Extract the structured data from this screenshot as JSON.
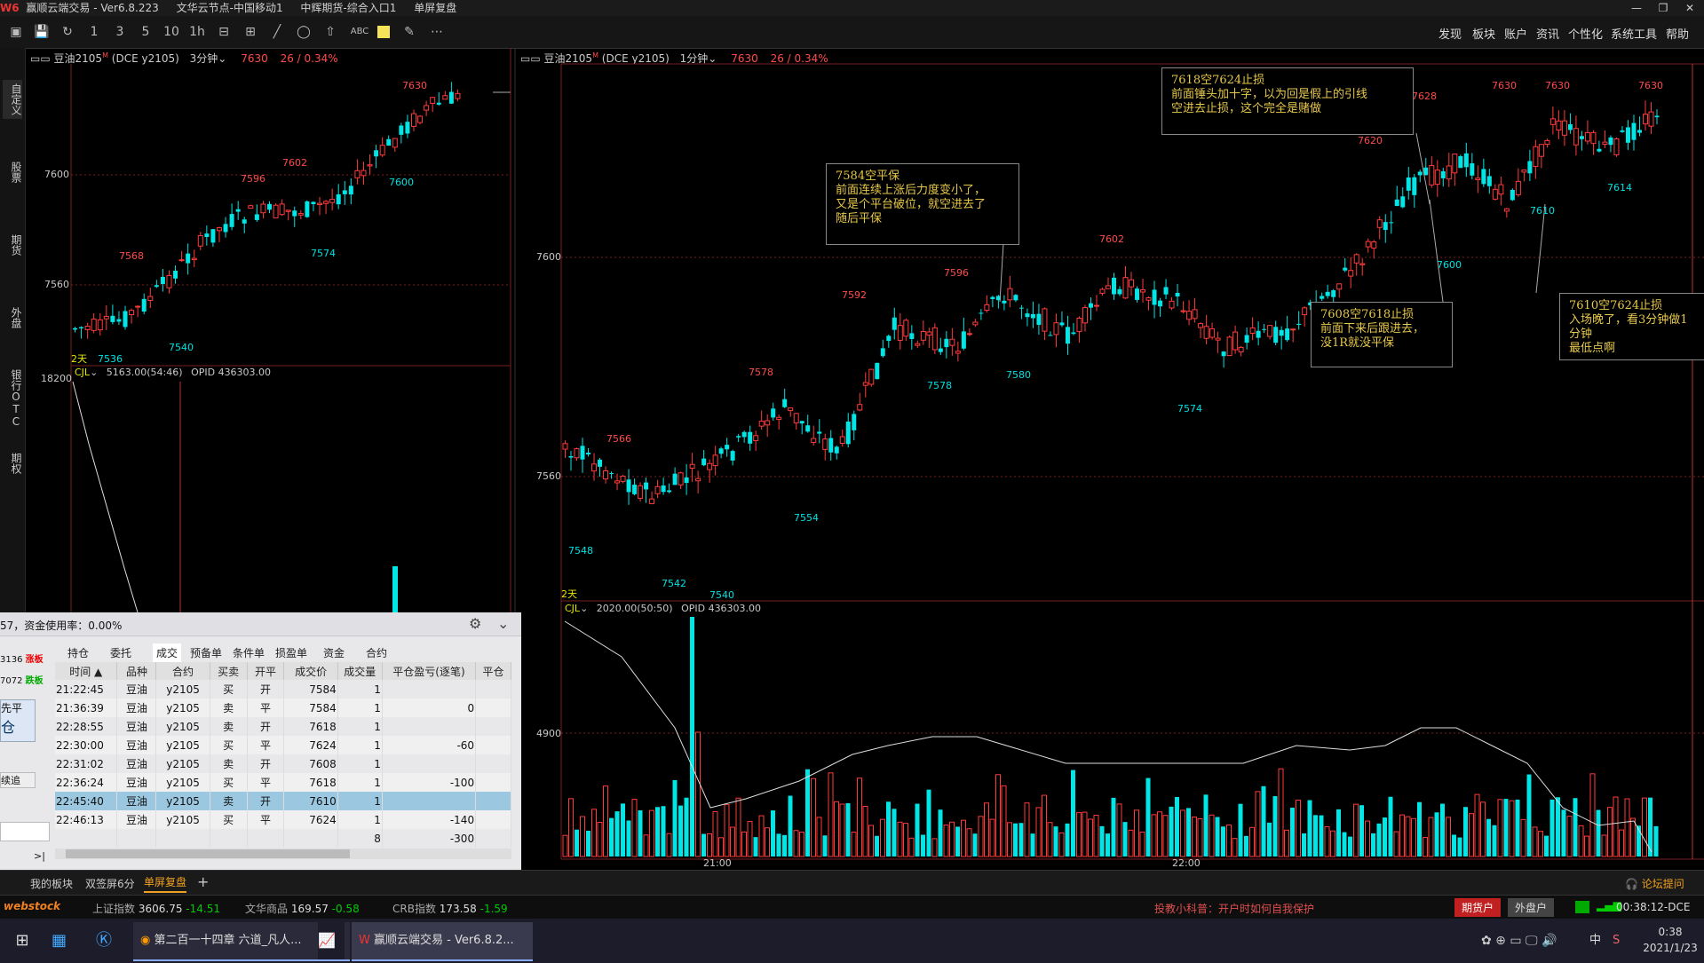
{
  "titlebar": {
    "app": "赢顺云端交易  - Ver6.8.223",
    "node": "文华云节点-中国移动1",
    "broker": "中辉期货-综合入口1",
    "mode": "单屏复盘"
  },
  "menu": [
    "发现",
    "板块",
    "账户",
    "资讯",
    "个性化",
    "系统工具",
    "帮助"
  ],
  "toolbar_icons": [
    "layout-icon",
    "save-icon",
    "refresh-icon",
    "1",
    "3",
    "5",
    "10",
    "1h",
    "grid-icon",
    "grid4-icon",
    "line-tool-icon",
    "ellipse-tool-icon",
    "arrow-up-icon",
    "ABC",
    "color-swatch-icon",
    "pen-icon",
    "more-icon"
  ],
  "sidebar_tabs": [
    "自定义",
    "股票",
    "期货",
    "外盘",
    "银行OTC",
    "期权"
  ],
  "left_chart": {
    "symbol": "豆油2105",
    "sup": "M",
    "exchange": "(DCE y2105)",
    "period": "3分钟",
    "last": "7630",
    "change": "26 / 0.34%",
    "price_labels": [
      "7600",
      "7560"
    ],
    "marks": [
      {
        "t": "7630",
        "c": "red"
      },
      {
        "t": "7602",
        "c": "red"
      },
      {
        "t": "7596",
        "c": "red"
      },
      {
        "t": "7568",
        "c": "red"
      },
      {
        "t": "7600",
        "c": "cyan"
      },
      {
        "t": "7574",
        "c": "cyan"
      },
      {
        "t": "7540",
        "c": "cyan"
      },
      {
        "t": "7536",
        "c": "cyan"
      }
    ],
    "days": "2天",
    "vol_label": "CJL",
    "vol_info": "5163.00(54:46)",
    "opid": "OPID 436303.00",
    "vol_axis": "18200"
  },
  "right_chart": {
    "symbol": "豆油2105",
    "sup": "M",
    "exchange": "(DCE y2105)",
    "period": "1分钟",
    "last": "7630",
    "change": "26 / 0.34%",
    "price_labels": [
      "7600",
      "7560"
    ],
    "marks": [
      {
        "t": "7630",
        "c": "red"
      },
      {
        "t": "7630",
        "c": "red"
      },
      {
        "t": "7630",
        "c": "red"
      },
      {
        "t": "7628",
        "c": "red"
      },
      {
        "t": "7620",
        "c": "red"
      },
      {
        "t": "7602",
        "c": "red"
      },
      {
        "t": "7596",
        "c": "red"
      },
      {
        "t": "7592",
        "c": "red"
      },
      {
        "t": "7578",
        "c": "red"
      },
      {
        "t": "7566",
        "c": "red"
      },
      {
        "t": "7614",
        "c": "cyan"
      },
      {
        "t": "7610",
        "c": "cyan"
      },
      {
        "t": "7600",
        "c": "cyan"
      },
      {
        "t": "7580",
        "c": "cyan"
      },
      {
        "t": "7578",
        "c": "cyan"
      },
      {
        "t": "7574",
        "c": "cyan"
      },
      {
        "t": "7554",
        "c": "cyan"
      },
      {
        "t": "7548",
        "c": "cyan"
      },
      {
        "t": "7542",
        "c": "cyan"
      },
      {
        "t": "7540",
        "c": "cyan"
      }
    ],
    "days": "2天",
    "vol_label": "CJL",
    "vol_info": "2020.00(50:50)",
    "opid": "OPID 436303.00",
    "vol_axis": "4900",
    "time_labels": [
      "21:00",
      "22:00"
    ]
  },
  "notes": [
    "7584空平保\n前面连续上涨后力度变小了，\n又是个平台破位，就空进去了\n随后平保",
    "7618空7624止损\n前面锤头加十字，以为回是假上的引线\n空进去止损，这个完全是赌做",
    "7608空7618止损\n前面下来后跟进去，\n没1R就没平保",
    "7610空7624止损\n入场晚了，看3分钟做1分钟\n最低点啊"
  ],
  "order_panel": {
    "fund_usage": "57，资金使用率：0.00%",
    "limit_up": "3136",
    "limit_up_label": "涨板",
    "limit_down": "7072",
    "limit_down_label": "跌板",
    "side_btn1": "先平",
    "side_btn2": "仓",
    "side_btn3": "续追",
    "tabs": [
      "持仓",
      "委托",
      "成交",
      "预备单",
      "条件单",
      "损盈单",
      "资金",
      "合约"
    ],
    "columns": [
      "时间 ▲",
      "品种",
      "合约",
      "买卖",
      "开平",
      "成交价",
      "成交量",
      "平仓盈亏(逐笔)",
      "平仓"
    ],
    "rows": [
      [
        "21:22:45",
        "豆油",
        "y2105",
        "买",
        "开",
        "7584",
        "1",
        ""
      ],
      [
        "21:36:39",
        "豆油",
        "y2105",
        "卖",
        "平",
        "7584",
        "1",
        "0"
      ],
      [
        "22:28:55",
        "豆油",
        "y2105",
        "卖",
        "开",
        "7618",
        "1",
        ""
      ],
      [
        "22:30:00",
        "豆油",
        "y2105",
        "买",
        "平",
        "7624",
        "1",
        "-60"
      ],
      [
        "22:31:02",
        "豆油",
        "y2105",
        "卖",
        "开",
        "7608",
        "1",
        ""
      ],
      [
        "22:36:24",
        "豆油",
        "y2105",
        "买",
        "平",
        "7618",
        "1",
        "-100"
      ],
      [
        "22:45:40",
        "豆油",
        "y2105",
        "卖",
        "开",
        "7610",
        "1",
        ""
      ],
      [
        "22:46:13",
        "豆油",
        "y2105",
        "买",
        "平",
        "7624",
        "1",
        "-140"
      ]
    ],
    "total_qty": "8",
    "total_pnl": "-300"
  },
  "bottom_tabs": [
    "我的板块",
    "双签屏6分",
    "单屏复盘",
    "+"
  ],
  "forum": "论坛提问",
  "ticker": {
    "brand": "webstock",
    "items": [
      {
        "name": "上证指数",
        "val": "3606.75",
        "chg": "-14.51"
      },
      {
        "name": "文华商品",
        "val": "169.57",
        "chg": "-0.58"
      },
      {
        "name": "CRB指数",
        "val": "173.58",
        "chg": "-1.59"
      }
    ],
    "tip": "投教小科普：开户时如何自我保护",
    "btn1": "期货户",
    "btn2": "外盘户",
    "clock": "00:38:12-DCE"
  },
  "taskbar": {
    "task1": "第二百一十四章 六道_凡人...",
    "task2": "赢顺云端交易 - Ver6.8.2...",
    "ime": "中",
    "time": "0:38",
    "date": "2021/1/23"
  },
  "colors": {
    "up": "#ff3b3b",
    "down": "#00e5e5",
    "grid": "#7a1f1f",
    "note": "#e6c84a"
  }
}
